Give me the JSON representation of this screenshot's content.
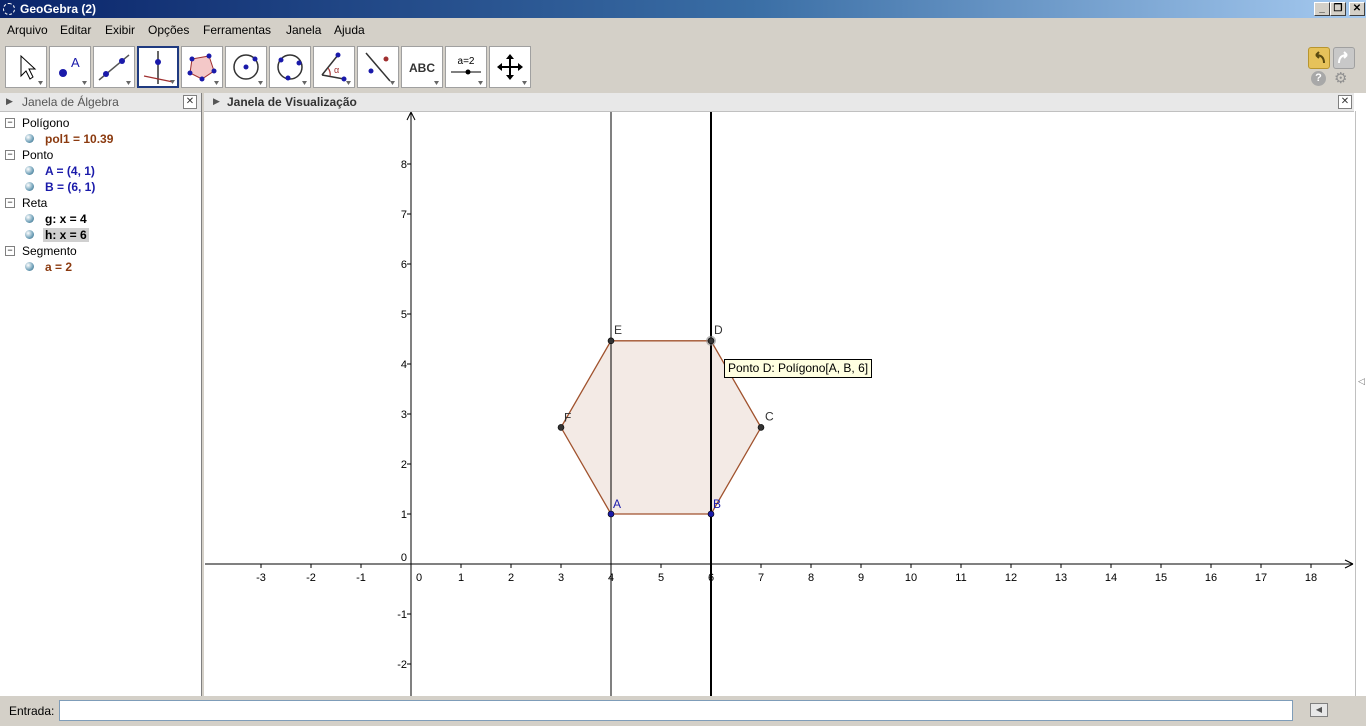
{
  "window": {
    "title": "GeoGebra (2)"
  },
  "menu": {
    "items": [
      "Arquivo",
      "Editar",
      "Exibir",
      "Opções",
      "Ferramentas",
      "Janela",
      "Ajuda"
    ]
  },
  "toolbar": {
    "tools": [
      "move-tool",
      "point-tool",
      "line-tool",
      "perpendicular-line-tool",
      "polygon-tool",
      "circle-tool",
      "conic-tool",
      "angle-tool",
      "reflect-tool",
      "text-tool",
      "slider-tool",
      "move-graphics-tool"
    ],
    "selected": "perpendicular-line-tool",
    "text_tool_label": "ABC",
    "slider_tool_label": "a=2"
  },
  "algebra": {
    "title": "Janela de Álgebra",
    "groups": [
      {
        "label": "Polígono",
        "objects": [
          {
            "text": "pol1 = 10.39",
            "color": "#8b3a0f"
          }
        ]
      },
      {
        "label": "Ponto",
        "objects": [
          {
            "text": "A = (4, 1)",
            "color": "#1a1aaa"
          },
          {
            "text": "B = (6, 1)",
            "color": "#1a1aaa"
          }
        ]
      },
      {
        "label": "Reta",
        "objects": [
          {
            "text": "g: x = 4",
            "color": "#000000"
          },
          {
            "text": "h: x = 6",
            "color": "#000000",
            "highlighted": true
          }
        ]
      },
      {
        "label": "Segmento",
        "objects": [
          {
            "text": "a = 2",
            "color": "#8b3a0f"
          }
        ]
      }
    ]
  },
  "graphics": {
    "title": "Janela de Visualização",
    "x_ticks": [
      "-3",
      "-2",
      "-1",
      "0",
      "1",
      "2",
      "3",
      "4",
      "5",
      "6",
      "7",
      "8",
      "9",
      "10",
      "11",
      "12",
      "13",
      "14",
      "15",
      "16",
      "17",
      "18"
    ],
    "y_ticks": [
      "8",
      "7",
      "6",
      "5",
      "4",
      "3",
      "2",
      "1",
      "0",
      "-1",
      "-2"
    ],
    "points": [
      {
        "name": "A",
        "x": 4,
        "y": 1,
        "color": "#1a1aaa"
      },
      {
        "name": "B",
        "x": 6,
        "y": 1,
        "color": "#1a1aaa"
      },
      {
        "name": "C",
        "x": 7,
        "y": 2.732,
        "color": "#333333"
      },
      {
        "name": "D",
        "x": 6,
        "y": 4.464,
        "color": "#333333"
      },
      {
        "name": "E",
        "x": 4,
        "y": 4.464,
        "color": "#333333"
      },
      {
        "name": "F",
        "x": 3,
        "y": 2.732,
        "color": "#333333"
      }
    ],
    "lines": [
      {
        "name": "g",
        "x": 4
      },
      {
        "name": "h",
        "x": 6
      }
    ],
    "polygon_color": "#a0522d",
    "tooltip": "Ponto D: Polígono[A, B, 6]"
  },
  "input": {
    "label": "Entrada:",
    "value": ""
  }
}
